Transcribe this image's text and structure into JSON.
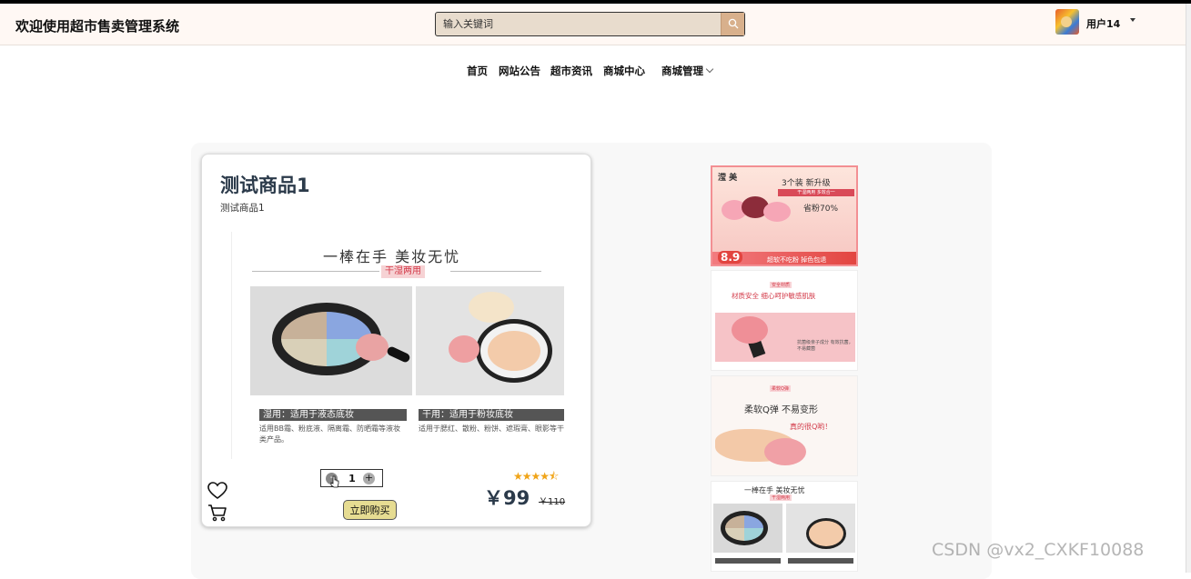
{
  "header": {
    "site_title": "欢迎使用超市售卖管理系统",
    "search": {
      "placeholder": "输入关键词"
    },
    "user": {
      "name": "用户14"
    }
  },
  "nav": {
    "items": [
      {
        "label": "首页"
      },
      {
        "label": "网站公告"
      },
      {
        "label": "超市资讯"
      },
      {
        "label": "商城中心"
      },
      {
        "label": "商城管理"
      }
    ]
  },
  "product": {
    "title": "测试商品1",
    "subtitle": "测试商品1",
    "image": {
      "heading": "一棒在手 美妆无忧",
      "tag": "干湿两用",
      "caption_left": "湿用：适用于液态底妆",
      "caption_right": "干用：适用于粉妆底妆",
      "desc_left": "适用BB霜、粉底液、隔离霜、防晒霜等液妆类产品。",
      "desc_right": "适用于腮红、散粉、粉饼、遮瑕膏、眼影等干粉类产品。"
    },
    "quantity": {
      "value": "1",
      "minus": "-",
      "plus": "+"
    },
    "rating": {
      "value": 4.5,
      "max": 5,
      "stars": "★★★★⯪"
    },
    "price": "￥99",
    "original_price": "￥110",
    "buy_label": "立即购买"
  },
  "thumbnails": {
    "t1": {
      "brand": "滢 美",
      "heading": "3个装 新升级",
      "band": "干湿两用 多效合一",
      "save": "省粉70%",
      "price": "8.9",
      "footer": "超软不吃粉 掉色包退"
    },
    "t2": {
      "tag": "安全材质",
      "heading": "材质安全 细心呵护敏感肌肤",
      "note": "抗菌级亲子成分 有效抗菌，不易藏菌"
    },
    "t3": {
      "tag": "柔软Q弹",
      "heading": "柔软Q弹 不易变形",
      "q": "真的很Q哟！"
    },
    "t4": {
      "heading": "一棒在手 美妆无忧",
      "tag": "干湿两用"
    }
  },
  "watermark": "CSDN @vx2_CXKF10088",
  "colors": {
    "header_bg": "#fff8f4",
    "search_bg": "#e8dccd",
    "search_button": "#d8b08c",
    "buy_button": "#e6dc92",
    "price": "#2b3a4a",
    "stars": "#f0a418"
  },
  "icons": [
    "search-icon",
    "chevron-down-icon",
    "heart-icon",
    "cart-icon",
    "cursor-icon"
  ]
}
